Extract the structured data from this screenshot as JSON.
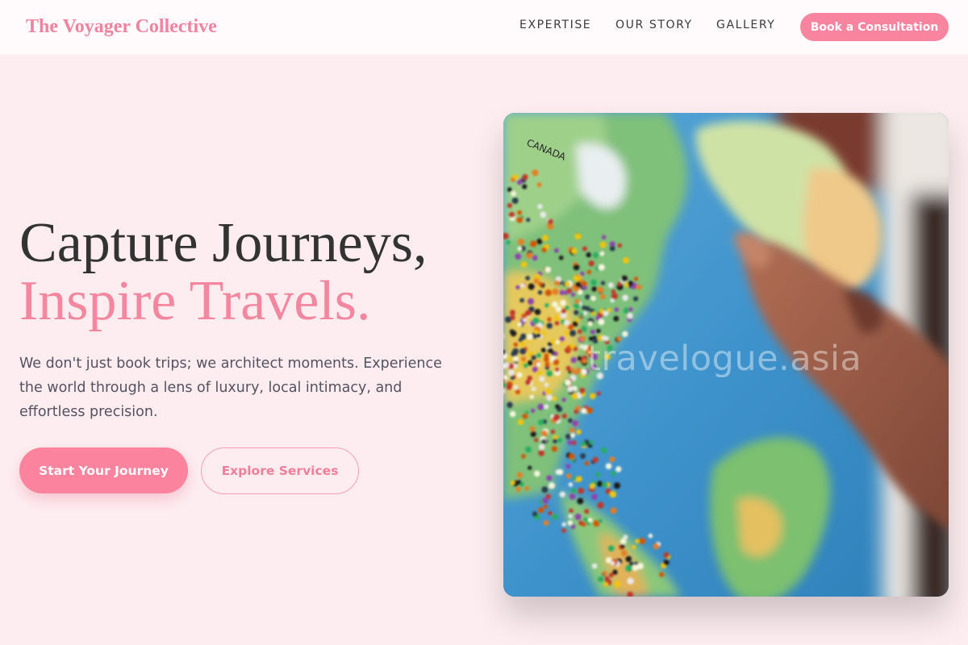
{
  "nav": {
    "brand": "The Voyager Collective",
    "links": [
      "EXPERTISE",
      "OUR STORY",
      "GALLERY"
    ],
    "cta": "Book a Consultation"
  },
  "hero": {
    "headline_line1": "Capture Journeys,",
    "headline_line2": "Inspire Travels.",
    "description": "We don't just book trips; we architect moments. Experience the world through a lens of luxury, local intimacy, and effortless precision.",
    "primary_button": "Start Your Journey",
    "secondary_button": "Explore Services",
    "image": {
      "watermark": "travelogue.asia",
      "map_label": "CANADA"
    }
  },
  "colors": {
    "accent": "#f8849f",
    "page_background": "#fdedf0",
    "nav_background": "#fffbfc",
    "heading": "#333333"
  }
}
